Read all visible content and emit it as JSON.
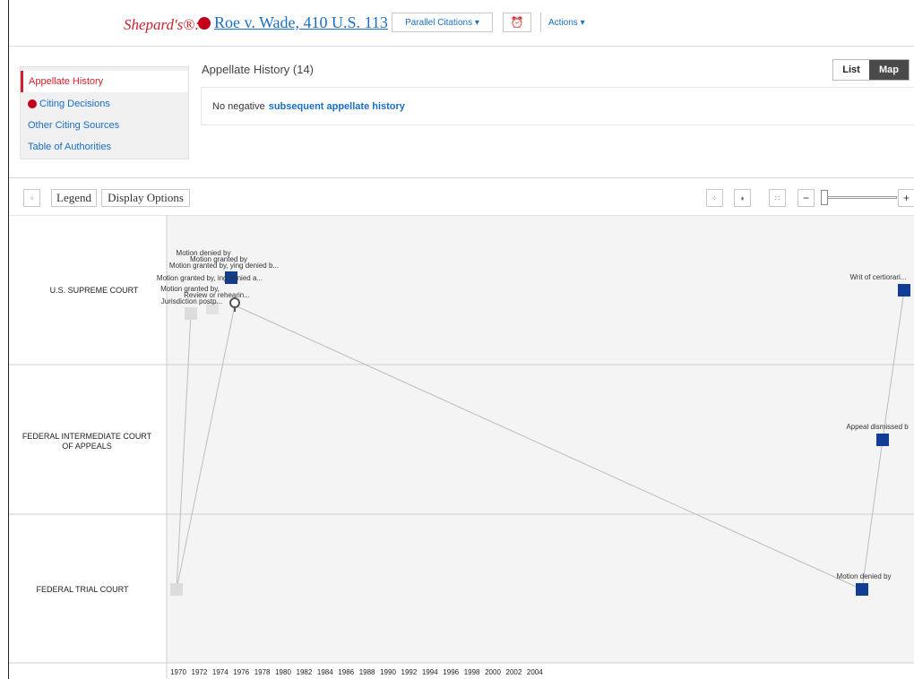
{
  "header": {
    "shepards_label": "Shepard's®:",
    "case_title": "Roe v. Wade, 410 U.S. 113",
    "parallel_label": "Parallel Citations ▾",
    "alert_icon": "alarm-clock-icon",
    "actions_label": "Actions ▾"
  },
  "sidebar": {
    "items": [
      {
        "label": "Appellate History"
      },
      {
        "label": "Citing Decisions"
      },
      {
        "label": "Other Citing Sources"
      },
      {
        "label": "Table of Authorities"
      }
    ]
  },
  "content": {
    "title": "Appellate History (14)",
    "toggle_list": "List",
    "toggle_map": "Map",
    "no_negative_text": "No negative",
    "no_negative_link": "subsequent appellate history"
  },
  "toolbar": {
    "legend": "Legend",
    "display_options": "Display Options",
    "minus": "−",
    "plus": "+"
  },
  "colors": {
    "red": "#d0202e",
    "link": "#1a6fc4",
    "node_dark": "#123d94",
    "node_light": "#dcdcdc"
  },
  "map": {
    "courts": [
      {
        "line1": "U.S. SUPREME COURT",
        "line2": ""
      },
      {
        "line1": "FEDERAL INTERMEDIATE COURT",
        "line2": "OF APPEALS"
      },
      {
        "line1": "FEDERAL TRIAL COURT",
        "line2": ""
      }
    ],
    "years": [
      "1970",
      "1972",
      "1974",
      "1976",
      "1978",
      "1980",
      "1982",
      "1984",
      "1986",
      "1988",
      "1990",
      "1992",
      "1994",
      "1996",
      "1998",
      "2000",
      "2002",
      "2004"
    ],
    "node_labels": [
      "Motion denied by",
      "Motion granted by",
      "Motion granted by, ying denied b...",
      "Motion granted by, ing denied a...",
      "Motion granted by,",
      "Review or rehearin...",
      "Jurisdiction postp...",
      "Writ of certiorari...",
      "Appeal dismissed b",
      "Motion denied by"
    ]
  }
}
